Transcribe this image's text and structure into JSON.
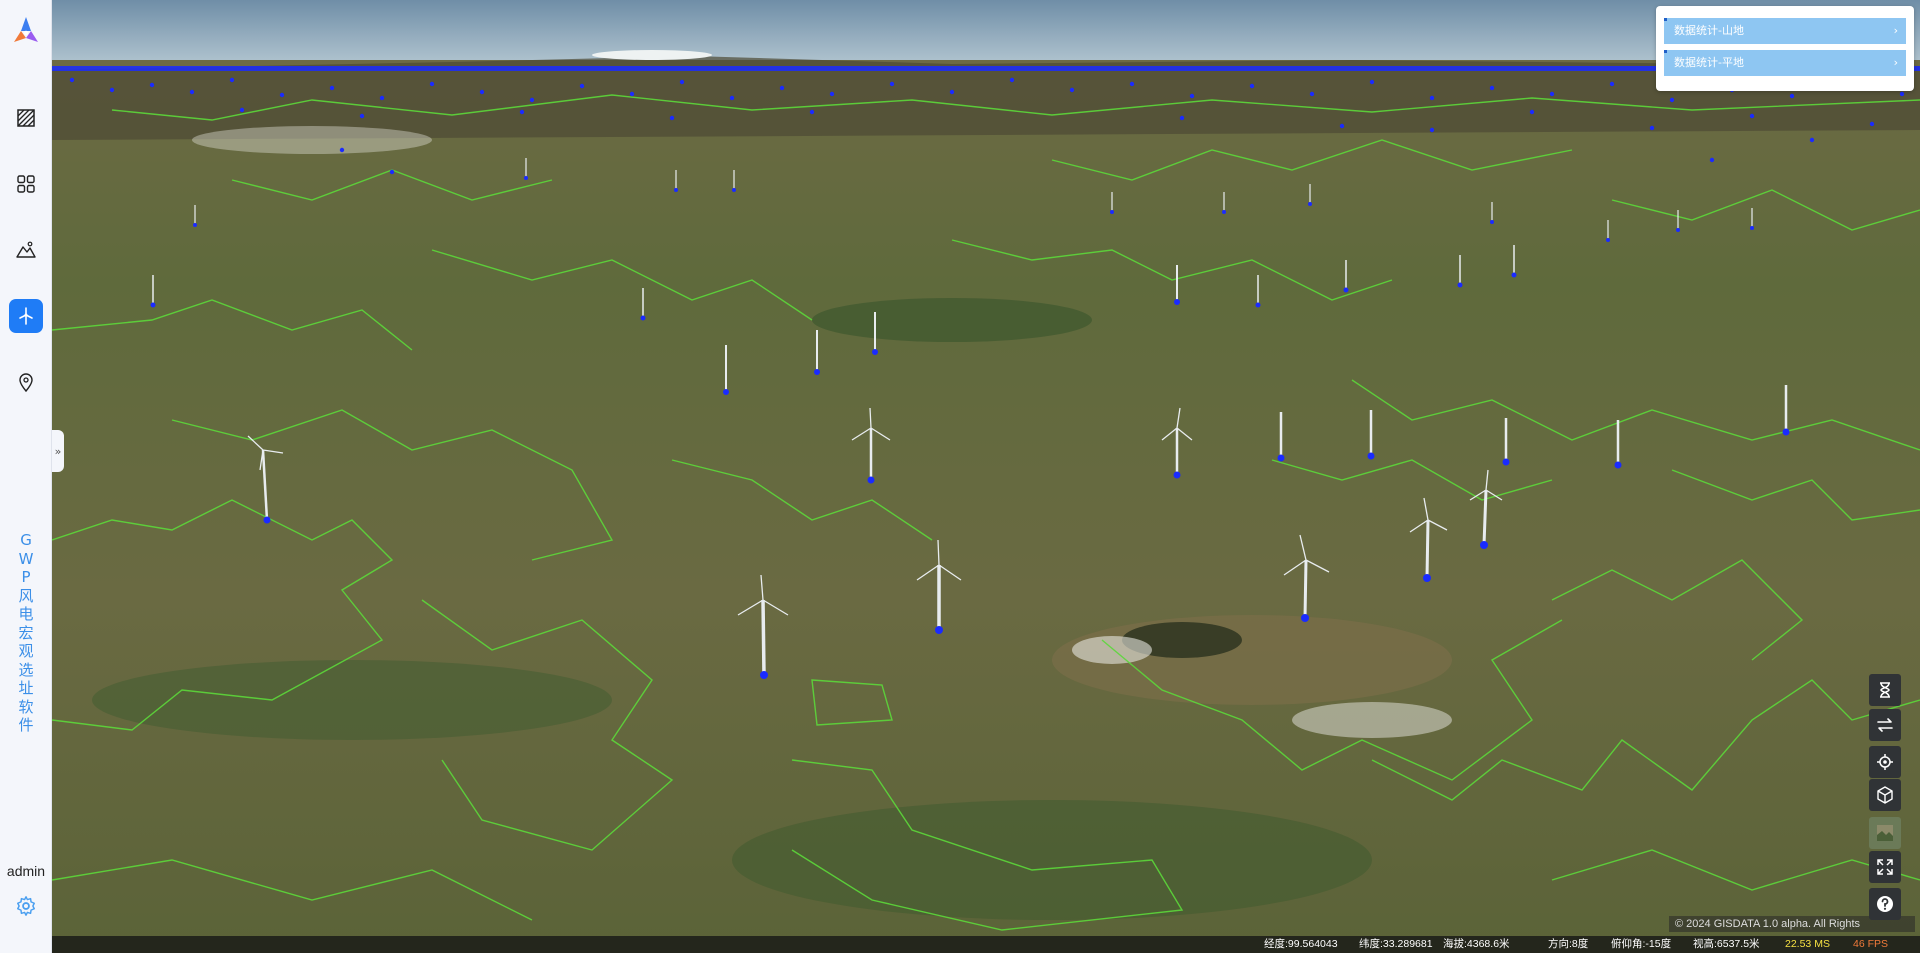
{
  "app": {
    "title_chars": [
      "G",
      "W",
      "P",
      "风",
      "电",
      "宏",
      "观",
      "选",
      "址",
      "软",
      "件"
    ],
    "user": "admin",
    "collapse_glyph": "»"
  },
  "sidebar": {
    "items": [
      {
        "icon": "hatch-layer-icon",
        "active": false
      },
      {
        "icon": "grid-apps-icon",
        "active": false
      },
      {
        "icon": "terrain-icon",
        "active": true
      },
      {
        "icon": "wind-turbine-icon",
        "active": true
      },
      {
        "icon": "location-pin-icon",
        "active": false
      }
    ]
  },
  "stats_panel": {
    "items": [
      {
        "label": "数据统计-山地",
        "chevron": "›"
      },
      {
        "label": "数据统计-平地",
        "chevron": "›"
      }
    ]
  },
  "tools": [
    "hourglass-icon",
    "swap-icon",
    "locate-icon",
    "cube-icon",
    "basemap-icon",
    "fullscreen-icon",
    "help-icon"
  ],
  "map": {
    "credit": "© 2024 GISDATA 1.0 alpha. All Rights",
    "accent_color": "#1f7cf6",
    "boundary_color": "#5cd83a",
    "marker_color": "#1a2bff"
  },
  "status": {
    "longitude": "经度:99.564043",
    "latitude": "纬度:33.289681",
    "altitude": "海拔:4368.6米",
    "heading": "方向:8度",
    "pitch": "俯仰角:-15度",
    "view_height": "视高:6537.5米",
    "ms": "22.53 MS",
    "fps": "46 FPS"
  }
}
